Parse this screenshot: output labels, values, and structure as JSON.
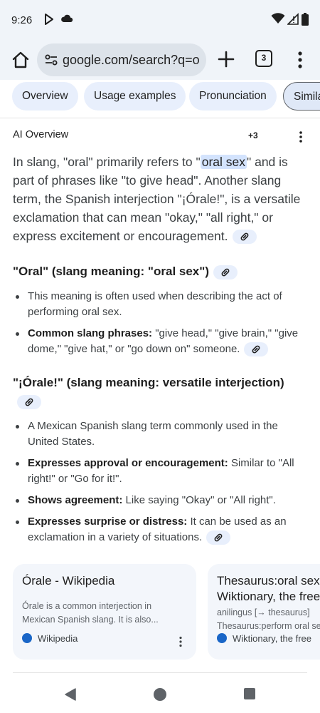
{
  "status_bar": {
    "time": "9:26",
    "left_icons": [
      "play-protect-icon",
      "cloud-icon"
    ],
    "right_icons": [
      "wifi-icon",
      "signal-icon",
      "battery-icon"
    ]
  },
  "browser": {
    "url": "google.com/search?q=o",
    "tab_count": "3"
  },
  "chips": [
    {
      "label": "Overview"
    },
    {
      "label": "Usage examples"
    },
    {
      "label": "Pronunciation"
    },
    {
      "label": "Simila"
    }
  ],
  "ai_overview": {
    "title": "AI Overview",
    "source_count": "+3",
    "intro_before": "In slang, \"oral\" primarily refers to \"",
    "intro_highlight": "oral sex",
    "intro_after": "\" and is part of phrases like \"to give head\". Another slang term, the Spanish interjection \"¡Órale!\", is a versatile exclamation that can mean \"okay,\" \"all right,\" or express excitement or encouragement.",
    "section1": {
      "heading": "\"Oral\" (slang meaning: \"oral sex\")",
      "bullets": [
        {
          "bold": "",
          "text": "This meaning is often used when describing the act of performing oral sex."
        },
        {
          "bold": "Common slang phrases:",
          "text": " \"give head,\" \"give brain,\" \"give dome,\" \"give hat,\" or \"go down on\" someone."
        }
      ]
    },
    "section2": {
      "heading": "\"¡Órale!\" (slang meaning: versatile interjection)",
      "bullets": [
        {
          "bold": "",
          "text": "A Mexican Spanish slang term commonly used in the United States."
        },
        {
          "bold": "Expresses approval or encouragement:",
          "text": " Similar to \"All right!\" or \"Go for it!\"."
        },
        {
          "bold": "Shows agreement:",
          "text": " Like saying \"Okay\" or \"All right\"."
        },
        {
          "bold": "Expresses surprise or distress:",
          "text": " It can be used as an exclamation in a variety of situations."
        }
      ]
    }
  },
  "cards": [
    {
      "title": "Órale - Wikipedia",
      "snippet_line1": "Órale is a common interjection in",
      "snippet_line2": "Mexican Spanish slang. It is also...",
      "source": "Wikipedia"
    },
    {
      "title_line1": "Thesaurus:oral sex",
      "title_line2": "Wiktionary, the free",
      "snippet_line1": "anilingus [→ thesaurus]",
      "snippet_line2": "Thesaurus:perform oral sex",
      "source": "Wiktionary, the free"
    }
  ]
}
